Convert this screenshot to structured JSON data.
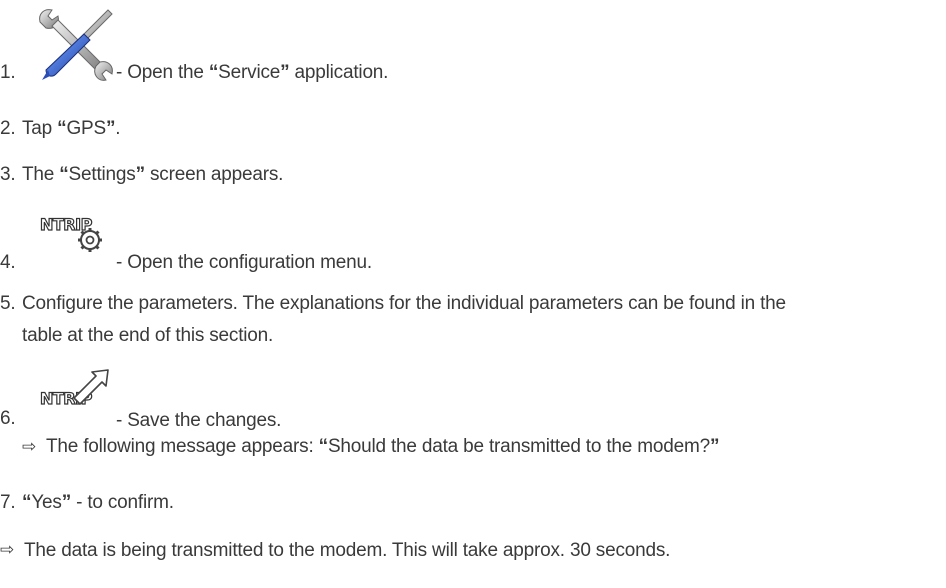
{
  "steps": [
    {
      "num": "1.",
      "after": " - Open the ",
      "q1": "“",
      "name": "Service",
      "q2": "”",
      "end": " application.",
      "icon": "wrench-screwdriver-icon"
    },
    {
      "num": "2.",
      "before": "Tap ",
      "q1": "“",
      "name": "GPS",
      "q2": "”",
      "end": "."
    },
    {
      "num": "3.",
      "before": "The ",
      "q1": "“",
      "name": "Settings",
      "q2": "”",
      "end": " screen appears."
    },
    {
      "num": "4.",
      "text": " - Open the configuration menu.",
      "icon": "ntrip-settings-icon",
      "icon_label": "NTRIP"
    },
    {
      "num": "5.",
      "line1": "Configure the parameters. The explanations for the individual parameters can be found in the",
      "line2": "table at the end of this section."
    },
    {
      "num": "6.",
      "text": " - Save the changes.",
      "icon": "ntrip-save-icon",
      "icon_label": "NTRIP",
      "result": {
        "arrow": "⇨",
        "before": "The following message appears: ",
        "q1": "“",
        "quote": "Should the data be transmitted to the modem?",
        "q2": "”"
      }
    },
    {
      "num": "7.",
      "q1": "“",
      "name": "Yes",
      "q2": "”",
      "end": " - to confirm."
    }
  ],
  "final_result": {
    "arrow": "⇨",
    "text": "The data is being transmitted to the modem. This will take approx. 30 seconds."
  }
}
